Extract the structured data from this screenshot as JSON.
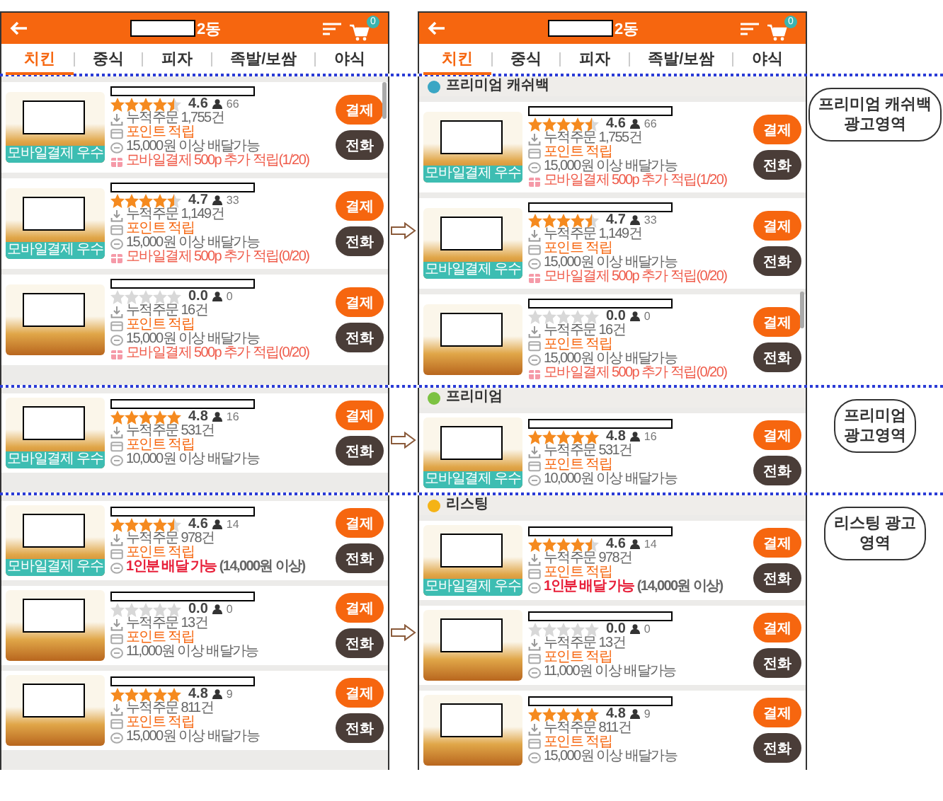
{
  "phones": [
    {
      "header": {
        "title": "2동",
        "cart_count": "0"
      },
      "tabs": [
        {
          "label": "치킨",
          "selected": true
        },
        {
          "label": "중식",
          "selected": false
        },
        {
          "label": "피자",
          "selected": false
        },
        {
          "label": "족발/보쌈",
          "selected": false
        },
        {
          "label": "야식",
          "selected": false
        }
      ]
    },
    {
      "header": {
        "title": "2동",
        "cart_count": "0"
      },
      "tabs": [
        {
          "label": "치킨",
          "selected": true
        },
        {
          "label": "중식",
          "selected": false
        },
        {
          "label": "피자",
          "selected": false
        },
        {
          "label": "족발/보쌈",
          "selected": false
        },
        {
          "label": "야식",
          "selected": false
        }
      ]
    }
  ],
  "bands": [
    {
      "label": "프리미엄 캐쉬백\n광고영역",
      "left_cards": [
        {
          "badge": "모바일결제 우수",
          "stars": 4.5,
          "score": "4.6",
          "reviews": "66",
          "pay": "결제",
          "call": "전화",
          "lines": [
            {
              "kind": "orders",
              "text": "누적주문 1,755건"
            },
            {
              "kind": "points",
              "text": "포인트 적립"
            },
            {
              "kind": "delivery",
              "text": "15,000원 이상 배달가능"
            },
            {
              "kind": "bonus",
              "text": "모바일결제 500p 추가 적립(1/20)"
            }
          ]
        },
        {
          "badge": "모바일결제 우수",
          "stars": 4.5,
          "score": "4.7",
          "reviews": "33",
          "pay": "결제",
          "call": "전화",
          "lines": [
            {
              "kind": "orders",
              "text": "누적주문 1,149건"
            },
            {
              "kind": "points",
              "text": "포인트 적립"
            },
            {
              "kind": "delivery",
              "text": "15,000원 이상 배달가능"
            },
            {
              "kind": "bonus",
              "text": "모바일결제 500p 추가 적립(0/20)"
            }
          ]
        },
        {
          "stars": 0,
          "score": "0.0",
          "reviews": "0",
          "pay": "결제",
          "call": "전화",
          "lines": [
            {
              "kind": "orders",
              "text": "누적주문 16건"
            },
            {
              "kind": "points",
              "text": "포인트 적립"
            },
            {
              "kind": "delivery",
              "text": "15,000원 이상 배달가능"
            },
            {
              "kind": "bonus",
              "text": "모바일결제 500p 추가 적립(0/20)"
            }
          ]
        }
      ],
      "section": {
        "title": "프리미엄 캐쉬백",
        "color": "#3aa6c4"
      },
      "right_cards": [
        {
          "badge": "모바일결제 우수",
          "stars": 4.5,
          "score": "4.6",
          "reviews": "66",
          "pay": "결제",
          "call": "전화",
          "lines": [
            {
              "kind": "orders",
              "text": "누적주문 1,755건"
            },
            {
              "kind": "points",
              "text": "포인트 적립"
            },
            {
              "kind": "delivery",
              "text": "15,000원 이상 배달가능"
            },
            {
              "kind": "bonus",
              "text": "모바일결제 500p 추가 적립(1/20)"
            }
          ]
        },
        {
          "badge": "모바일결제 우수",
          "stars": 4.5,
          "score": "4.7",
          "reviews": "33",
          "pay": "결제",
          "call": "전화",
          "lines": [
            {
              "kind": "orders",
              "text": "누적주문 1,149건"
            },
            {
              "kind": "points",
              "text": "포인트 적립"
            },
            {
              "kind": "delivery",
              "text": "15,000원 이상 배달가능"
            },
            {
              "kind": "bonus",
              "text": "모바일결제 500p 추가 적립(0/20)"
            }
          ]
        },
        {
          "stars": 0,
          "score": "0.0",
          "reviews": "0",
          "pay": "결제",
          "call": "전화",
          "lines": [
            {
              "kind": "orders",
              "text": "누적주문 16건"
            },
            {
              "kind": "points",
              "text": "포인트 적립"
            },
            {
              "kind": "delivery",
              "text": "15,000원 이상 배달가능"
            },
            {
              "kind": "bonus",
              "text": "모바일결제 500p 추가 적립(0/20)"
            }
          ]
        }
      ]
    },
    {
      "label": "프리미엄\n광고영역",
      "left_cards": [
        {
          "badge": "모바일결제 우수",
          "stars": 5,
          "score": "4.8",
          "reviews": "16",
          "pay": "결제",
          "call": "전화",
          "lines": [
            {
              "kind": "orders",
              "text": "누적주문 531건"
            },
            {
              "kind": "points",
              "text": "포인트 적립"
            },
            {
              "kind": "delivery",
              "text": "10,000원 이상 배달가능"
            }
          ]
        }
      ],
      "section": {
        "title": "프리미엄",
        "color": "#7cc242"
      },
      "right_cards": [
        {
          "badge": "모바일결제 우수",
          "stars": 5,
          "score": "4.8",
          "reviews": "16",
          "pay": "결제",
          "call": "전화",
          "lines": [
            {
              "kind": "orders",
              "text": "누적주문 531건"
            },
            {
              "kind": "points",
              "text": "포인트 적립"
            },
            {
              "kind": "delivery",
              "text": "10,000원 이상 배달가능"
            }
          ]
        }
      ]
    },
    {
      "label": "리스팅 광고\n영역",
      "left_cards": [
        {
          "badge": "모바일결제 우수",
          "stars": 4.5,
          "score": "4.6",
          "reviews": "14",
          "pay": "결제",
          "call": "전화",
          "lines": [
            {
              "kind": "orders",
              "text": "누적주문 978건"
            },
            {
              "kind": "points",
              "text": "포인트 적립"
            },
            {
              "kind": "single",
              "text": "1인분 배달 가능",
              "note": "(14,000원 이상)"
            }
          ]
        },
        {
          "stars": 0,
          "score": "0.0",
          "reviews": "0",
          "pay": "결제",
          "call": "전화",
          "lines": [
            {
              "kind": "orders",
              "text": "누적주문 13건"
            },
            {
              "kind": "points",
              "text": "포인트 적립"
            },
            {
              "kind": "delivery",
              "text": "11,000원 이상 배달가능"
            }
          ]
        },
        {
          "stars": 5,
          "score": "4.8",
          "reviews": "9",
          "pay": "결제",
          "call": "전화",
          "lines": [
            {
              "kind": "orders",
              "text": "누적주문 811건"
            },
            {
              "kind": "points",
              "text": "포인트 적립"
            },
            {
              "kind": "delivery",
              "text": "15,000원 이상 배달가능"
            }
          ]
        }
      ],
      "section": {
        "title": "리스팅",
        "color": "#f5b316"
      },
      "right_cards": [
        {
          "badge": "모바일결제 우수",
          "stars": 4.5,
          "score": "4.6",
          "reviews": "14",
          "pay": "결제",
          "call": "전화",
          "lines": [
            {
              "kind": "orders",
              "text": "누적주문 978건"
            },
            {
              "kind": "points",
              "text": "포인트 적립"
            },
            {
              "kind": "single",
              "text": "1인분 배달 가능",
              "note": "(14,000원 이상)"
            }
          ]
        },
        {
          "stars": 0,
          "score": "0.0",
          "reviews": "0",
          "pay": "결제",
          "call": "전화",
          "lines": [
            {
              "kind": "orders",
              "text": "누적주문 13건"
            },
            {
              "kind": "points",
              "text": "포인트 적립"
            },
            {
              "kind": "delivery",
              "text": "11,000원 이상 배달가능"
            }
          ]
        },
        {
          "stars": 5,
          "score": "4.8",
          "reviews": "9",
          "pay": "결제",
          "call": "전화",
          "lines": [
            {
              "kind": "orders",
              "text": "누적주문 811건"
            },
            {
              "kind": "points",
              "text": "포인트 적립"
            },
            {
              "kind": "delivery",
              "text": "15,000원 이상 배달가능"
            }
          ]
        }
      ]
    }
  ]
}
